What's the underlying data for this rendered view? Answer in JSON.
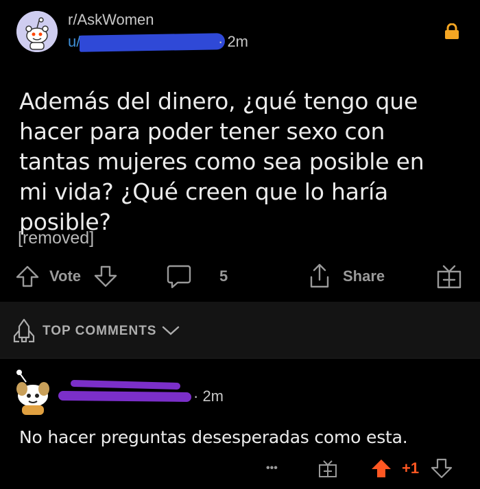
{
  "post": {
    "subreddit": "r/AskWomen",
    "user_prefix": "u/",
    "time": "· 2m",
    "title": "Además del dinero, ¿qué tengo que hacer para poder tener sexo con tantas mujeres como sea posible en mi vida? ¿Qué creen que lo haría posible?",
    "body": "[removed]",
    "vote_label": "Vote",
    "comment_count": "5",
    "share_label": "Share",
    "locked": true
  },
  "comments_sort": {
    "label": "TOP COMMENTS"
  },
  "comment": {
    "time": "· 2m",
    "body": "No hacer preguntas desesperadas como esta.",
    "more_label": "•••",
    "score": "+1"
  },
  "colors": {
    "background": "#000000",
    "sort_bar": "#141414",
    "user_link": "#3f8fd8",
    "lock": "#f5a623",
    "upvote_active": "#ff5722",
    "icon_gray": "#9a9a9a"
  }
}
